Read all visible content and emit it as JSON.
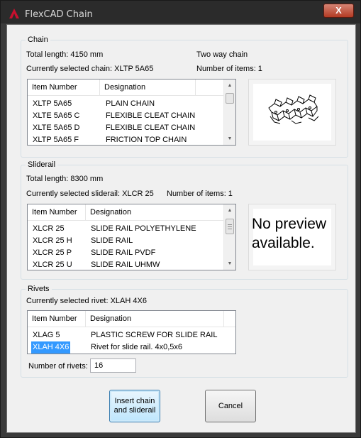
{
  "window": {
    "title": "FlexCAD Chain",
    "close_label": "X"
  },
  "chain": {
    "group_title": "Chain",
    "total_length": "Total length: 4150 mm",
    "mode": "Two way chain",
    "selected": "Currently selected chain: XLTP 5A65",
    "count": "Number of items: 1",
    "columns": [
      "Item Number",
      "Designation"
    ],
    "rows": [
      [
        "XLTP 5A65",
        "PLAIN CHAIN"
      ],
      [
        "XLTE 5A65 C",
        "FLEXIBLE CLEAT CHAIN"
      ],
      [
        "XLTE 5A65 D",
        "FLEXIBLE CLEAT CHAIN"
      ],
      [
        "XLTP 5A65 F",
        "FRICTION TOP CHAIN"
      ]
    ]
  },
  "sliderail": {
    "group_title": "Sliderail",
    "total_length": "Total length: 8300 mm",
    "selected": "Currently selected sliderail: XLCR 25",
    "count": "Number of items: 1",
    "columns": [
      "Item Number",
      "Designation"
    ],
    "rows": [
      [
        "XLCR 25",
        "SLIDE RAIL POLYETHYLENE"
      ],
      [
        "XLCR 25 H",
        "SLIDE RAIL"
      ],
      [
        "XLCR 25 P",
        "SLIDE RAIL PVDF"
      ],
      [
        "XLCR 25 U",
        "SLIDE RAIL UHMW"
      ]
    ],
    "preview_text_1": "No preview",
    "preview_text_2": "available."
  },
  "rivets": {
    "group_title": "Rivets",
    "selected": "Currently selected rivet: XLAH 4X6",
    "columns": [
      "Item Number",
      "Designation"
    ],
    "rows": [
      [
        "XLAG 5",
        "PLASTIC SCREW FOR SLIDE RAIL"
      ],
      [
        "XLAH 4X6",
        "Rivet for slide rail. 4x0,5x6"
      ]
    ],
    "count_label": "Number of rivets:",
    "count_value": "16"
  },
  "buttons": {
    "insert_line1": "Insert chain",
    "insert_line2": "and sliderail",
    "cancel": "Cancel"
  },
  "colors": {
    "selection": "#3399ff",
    "title_bar": "#2b2b2b",
    "close": "#c7503b"
  },
  "icons": {
    "app": "autocad-logo-icon",
    "preview": "chain-3d-preview-icon"
  }
}
